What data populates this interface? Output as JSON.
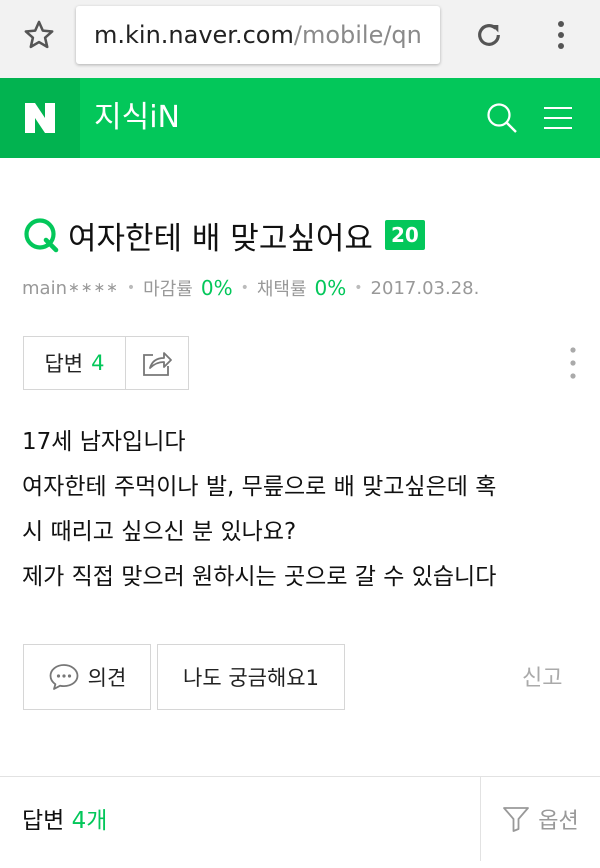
{
  "browser": {
    "url_host": "m.kin.naver.com",
    "url_path": "/mobile/qn"
  },
  "header": {
    "logo_letter": "N",
    "service_title": "지식iN"
  },
  "question": {
    "title": "여자한테 배 맞고싶어요",
    "points": "20",
    "author": "main",
    "author_mask": "∗∗∗∗",
    "deadline_label": "마감률",
    "deadline_rate": "0%",
    "adoption_label": "채택률",
    "adoption_rate": "0%",
    "date": "2017.03.28.",
    "body_lines": [
      "17세 남자입니다",
      "여자한테 주먹이나 발, 무릎으로 배 맞고싶은데 혹",
      "시 때리고 싶으신 분 있나요?",
      "제가 직접 맞으러 원하시는 곳으로 갈 수 있습니다"
    ]
  },
  "actions": {
    "answer_label": "답변",
    "answer_count": "4",
    "opinion_label": "의견",
    "curious_label": "나도 궁금해요1",
    "report_label": "신고"
  },
  "answers_bar": {
    "label": "답변",
    "count": "4개",
    "options_label": "옵션"
  },
  "colors": {
    "brand_green": "#03c75a",
    "logo_green": "#02b350"
  },
  "icons": [
    "star-icon",
    "reload-icon",
    "overflow-menu-icon",
    "search-icon",
    "hamburger-icon",
    "question-q-icon",
    "share-icon",
    "more-vertical-icon",
    "speech-bubble-icon",
    "filter-icon"
  ]
}
